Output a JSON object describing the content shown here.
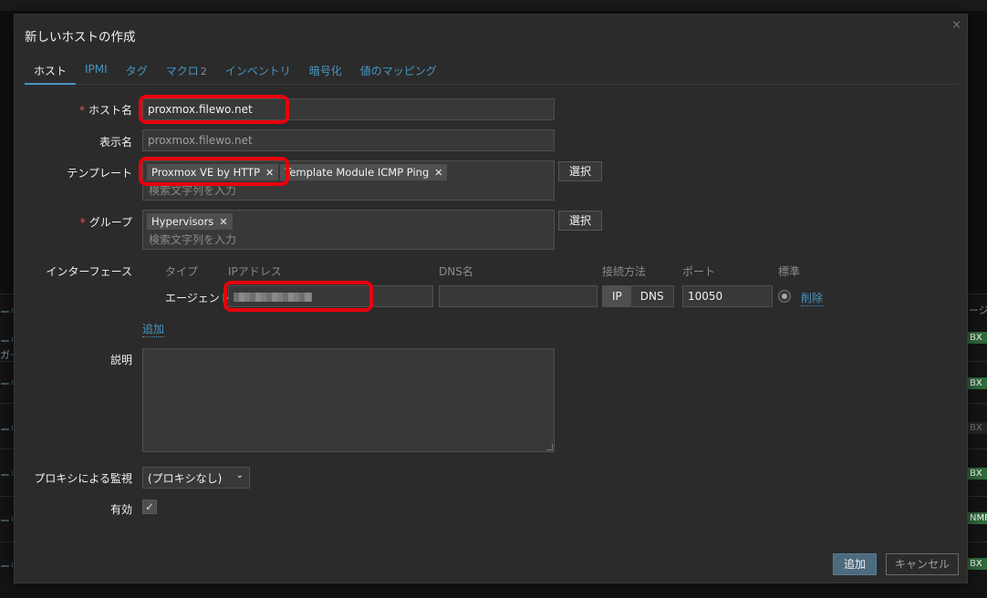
{
  "background": {
    "right_header": "ージ",
    "right_badges": [
      "BX",
      "BX",
      "BX",
      "BX",
      "NMF",
      "BX"
    ],
    "left_texts": [
      "ーリ",
      "ガー",
      "ーリ",
      "ーリ",
      "ーリ",
      "ーリ",
      "ーリ"
    ]
  },
  "modal": {
    "title": "新しいホストの作成",
    "close_label": "×",
    "tabs": [
      {
        "label": "ホスト",
        "active": true
      },
      {
        "label": "IPMI"
      },
      {
        "label": "タグ"
      },
      {
        "label": "マクロ",
        "count": "2"
      },
      {
        "label": "インベントリ"
      },
      {
        "label": "暗号化"
      },
      {
        "label": "値のマッピング"
      }
    ]
  },
  "form": {
    "hostname": {
      "label": "ホスト名",
      "required_mark": "*",
      "value": "proxmox.filewo.net"
    },
    "visible_name": {
      "label": "表示名",
      "placeholder": "proxmox.filewo.net"
    },
    "templates": {
      "label": "テンプレート",
      "chips": [
        "Proxmox VE by HTTP",
        "Template Module ICMP Ping"
      ],
      "placeholder": "検索文字列を入力",
      "select_button": "選択"
    },
    "groups": {
      "label": "グループ",
      "required_mark": "*",
      "chips": [
        "Hypervisors"
      ],
      "placeholder": "検索文字列を入力",
      "select_button": "選択"
    },
    "interfaces": {
      "label": "インターフェース",
      "columns": {
        "type": "タイプ",
        "ip": "IPアドレス",
        "dns": "DNS名",
        "connect": "接続方法",
        "port": "ポート",
        "default": "標準"
      },
      "row": {
        "type": "エージェント",
        "ip": "",
        "dns": "",
        "connect_options": [
          "IP",
          "DNS"
        ],
        "connect_selected": "IP",
        "port": "10050",
        "remove": "削除"
      },
      "add": "追加"
    },
    "description": {
      "label": "説明",
      "value": ""
    },
    "proxy": {
      "label": "プロキシによる監視",
      "value": "(プロキシなし)"
    },
    "enabled": {
      "label": "有効",
      "checked": true
    }
  },
  "footer": {
    "add_button": "追加",
    "cancel_button": "キャンセル"
  },
  "colors": {
    "accent": "#4796c4",
    "highlight": "#e8000d",
    "required": "#e45959"
  }
}
